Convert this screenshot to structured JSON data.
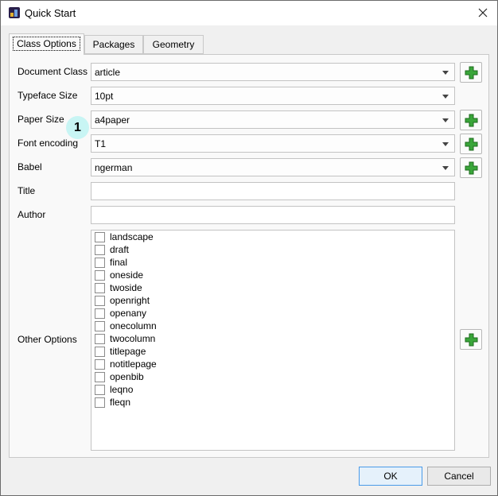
{
  "window": {
    "title": "Quick Start"
  },
  "tabs": [
    {
      "label": "Class Options",
      "active": true
    },
    {
      "label": "Packages",
      "active": false
    },
    {
      "label": "Geometry",
      "active": false
    }
  ],
  "form": {
    "document_class": {
      "label": "Document Class",
      "value": "article"
    },
    "typeface_size": {
      "label": "Typeface Size",
      "value": "10pt"
    },
    "paper_size": {
      "label": "Paper Size",
      "value": "a4paper"
    },
    "font_encoding": {
      "label": "Font encoding",
      "value": "T1"
    },
    "babel": {
      "label": "Babel",
      "value": "ngerman"
    },
    "title": {
      "label": "Title",
      "value": ""
    },
    "author": {
      "label": "Author",
      "value": ""
    },
    "other_options": {
      "label": "Other Options",
      "items": [
        {
          "label": "landscape",
          "checked": false
        },
        {
          "label": "draft",
          "checked": false
        },
        {
          "label": "final",
          "checked": false
        },
        {
          "label": "oneside",
          "checked": false
        },
        {
          "label": "twoside",
          "checked": false
        },
        {
          "label": "openright",
          "checked": false
        },
        {
          "label": "openany",
          "checked": false
        },
        {
          "label": "onecolumn",
          "checked": false
        },
        {
          "label": "twocolumn",
          "checked": false
        },
        {
          "label": "titlepage",
          "checked": false
        },
        {
          "label": "notitlepage",
          "checked": false
        },
        {
          "label": "openbib",
          "checked": false
        },
        {
          "label": "leqno",
          "checked": false
        },
        {
          "label": "fleqn",
          "checked": false
        }
      ]
    }
  },
  "annotation_badge": "1",
  "buttons": {
    "ok": "OK",
    "cancel": "Cancel"
  },
  "icons": {
    "app": "texstudio-app-icon",
    "close": "close-icon",
    "add": "green-plus-icon"
  },
  "colors": {
    "plus_green": "#3aa63a",
    "badge": "#c8f5f4",
    "ok_border": "#4a9be8"
  }
}
